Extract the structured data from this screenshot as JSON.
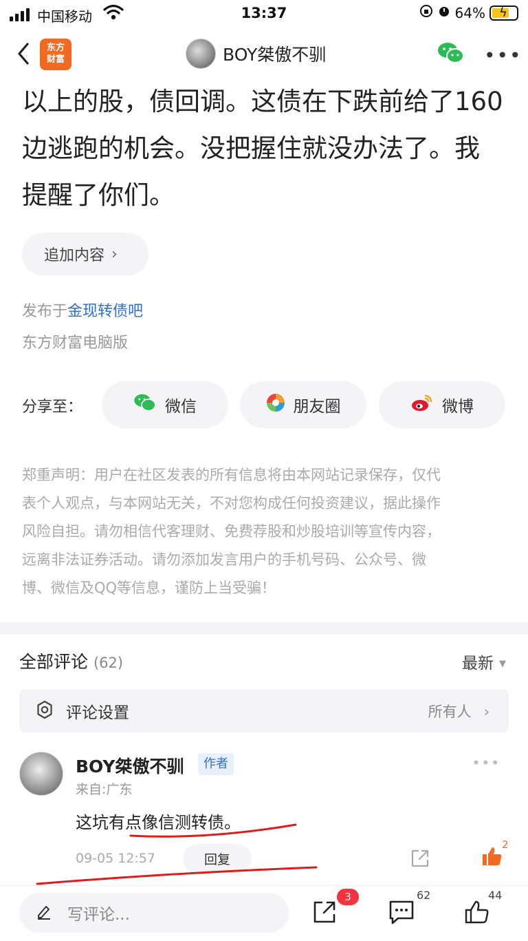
{
  "status_bar": {
    "carrier": "中国移动",
    "time": "13:37",
    "battery": "64%"
  },
  "nav": {
    "logo_line1": "东方",
    "logo_line2": "财富",
    "title": "BOY桀傲不驯"
  },
  "article": {
    "lines": [
      "以上的股，债回调。这债在下跌前给了160",
      "边逃跑的机会。没把握住就没办法了。我",
      "提醒了你们。"
    ],
    "append_label": "追加内容",
    "publish_prefix": "发布于",
    "publish_forum": "金现转债吧",
    "source": "东方财富电脑版"
  },
  "share": {
    "label": "分享至：",
    "targets": [
      "微信",
      "朋友圈",
      "微博"
    ]
  },
  "disclaimer": [
    "郑重声明：用户在社区发表的所有信息将由本网站记录保存，仅代",
    "表个人观点，与本网站无关，不对您构成任何投资建议，据此操作",
    "风险自担。请勿相信代客理财、免费荐股和炒股培训等宣传内容，",
    "远离非法证券活动。请勿添加发言用户的手机号码、公众号、微",
    "博、微信及QQ等信息，谨防上当受骗！"
  ],
  "comments": {
    "title": "全部评论",
    "count": "(62)",
    "sort": "最新",
    "settings_label": "评论设置",
    "settings_value": "所有人",
    "items": [
      {
        "author": "BOY桀傲不驯",
        "badge": "作者",
        "from": "来自:广东",
        "text": "这坑有点像信测转债。",
        "time": "09-05 12:57",
        "reply": "回复",
        "likes": "2"
      }
    ]
  },
  "bottom_bar": {
    "placeholder": "写评论...",
    "share_badge": "3",
    "comment_count": "62",
    "like_count": "44"
  },
  "colors": {
    "brand_orange": "#f26a21",
    "link_blue": "#2f6fd6",
    "badge_red": "#f5333f",
    "annotation_red": "#e01b1b"
  },
  "icons": [
    "back-chevron-icon",
    "wechat-icon",
    "moments-icon",
    "weibo-icon",
    "gear-icon",
    "share-icon",
    "thumbs-up-icon",
    "comment-icon",
    "pen-icon"
  ]
}
